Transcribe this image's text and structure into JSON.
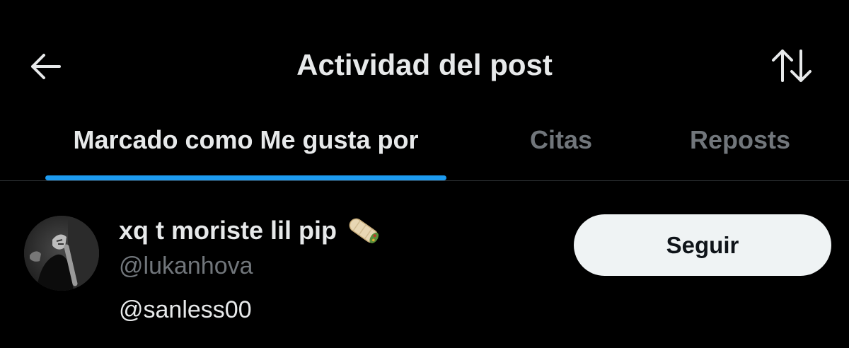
{
  "header": {
    "title": "Actividad del post",
    "back_icon": "arrow-left-icon",
    "sort_icon": "sort-arrows-icon"
  },
  "tabs": [
    {
      "label": "Marcado como Me gusta por",
      "active": true
    },
    {
      "label": "Citas",
      "active": false
    },
    {
      "label": "Reposts",
      "active": false
    }
  ],
  "users": [
    {
      "display_name": "xq t moriste lil pip",
      "name_emoji": "burrito-emoji",
      "handle": "@lukanhova",
      "bio": "@sanless00",
      "follow_label": "Seguir"
    }
  ],
  "colors": {
    "background": "#000000",
    "text_primary": "#e7e9ea",
    "text_secondary": "#71767b",
    "accent": "#1d9bf0",
    "divider": "#2f3336",
    "button_bg": "#eff3f4",
    "button_text": "#0f1419"
  }
}
